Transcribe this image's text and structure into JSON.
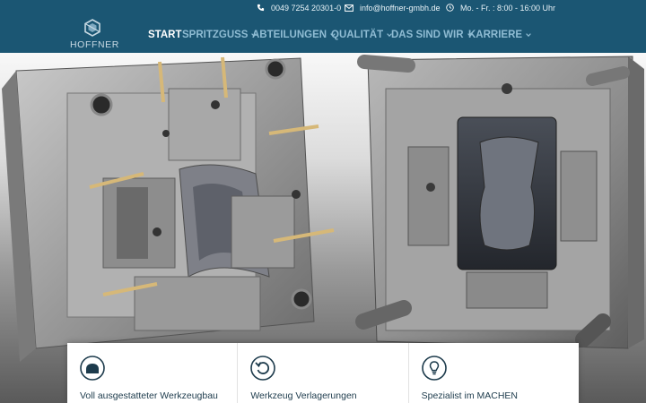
{
  "topbar": {
    "phone": "0049 7254 20301-0",
    "email": "info@hoffner-gmbh.de",
    "hours": "Mo. - Fr. : 8:00 - 16:00 Uhr"
  },
  "brand": {
    "name": "HOFFNER"
  },
  "nav": {
    "items": [
      {
        "label": "START"
      },
      {
        "label": "SPRITZGUSS"
      },
      {
        "label": "ABTEILUNGEN"
      },
      {
        "label": "QUALITÄT"
      },
      {
        "label": "DAS SIND WIR"
      },
      {
        "label": "KARRIERE"
      }
    ]
  },
  "cards": [
    {
      "icon": "mold-icon",
      "title": "Voll ausgestatteter Werkzeugbau"
    },
    {
      "icon": "refresh-icon",
      "title": "Werkzeug Verlagerungen"
    },
    {
      "icon": "lightbulb-icon",
      "title": "Spezialist im MACHEN"
    }
  ],
  "colors": {
    "header_bg": "#1b5673",
    "nav_inactive": "#8fbcd3",
    "card_icon": "#1d3b4c"
  }
}
